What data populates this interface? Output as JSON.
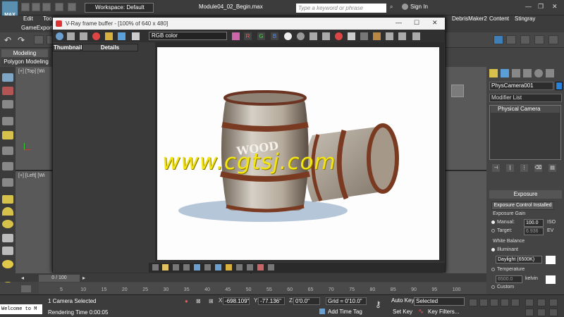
{
  "app": {
    "logo_text": "MAX",
    "document_title": "Module04_02_Begin.max",
    "workspace": "Workspace: Default",
    "search_placeholder": "Type a keyword or phrase",
    "sign_in": "Sign In"
  },
  "menus": [
    "Edit",
    "Too",
    "DebrisMaker2",
    "Content",
    "Stingray"
  ],
  "gamebar_label": "GameExporte",
  "ribbon": {
    "tab": "Modeling",
    "subtab": "Polygon Modeling"
  },
  "viewports": {
    "top": "[+] [Top] [Wi",
    "left": "[+] [Left] [Wi"
  },
  "vfb": {
    "title": "V-Ray frame buffer - [100% of 640 x 480]",
    "channel": "RGB color",
    "rgb_buttons": [
      "R",
      "G",
      "B"
    ],
    "side_tabs": [
      "Thumbnail",
      "Details"
    ]
  },
  "command_panel": {
    "object_name": "PhysCamera001",
    "object_color": "#2a82d8",
    "modifier_list": "Modifier List",
    "stack_item": "Physical Camera",
    "exposure_rollout": "Exposure",
    "exposure_control_button": "Exposure Control Installed",
    "exposure_gain_label": "Exposure Gain",
    "manual_label": "Manual:",
    "manual_value": "100.0",
    "manual_unit": "ISO",
    "target_label": "Target:",
    "target_value": "6.936",
    "target_unit": "EV",
    "white_balance_label": "White Balance",
    "illuminant_label": "Illuminant",
    "illuminant_value": "Daylight (6500K)",
    "temperature_label": "Temperature",
    "temperature_value": "6500.0",
    "temperature_unit": "kelvin",
    "custom_label": "Custom"
  },
  "timeline": {
    "slider": "0 / 100",
    "ticks": [
      "5",
      "10",
      "15",
      "20",
      "25",
      "30",
      "35",
      "40",
      "45",
      "50",
      "55",
      "60",
      "65",
      "70",
      "75",
      "80",
      "85",
      "90",
      "95",
      "100"
    ]
  },
  "status": {
    "maxscript": "Welcome to M",
    "selection": "1 Camera Selected",
    "render_time": "Rendering Time  0:00:05",
    "x_label": "X:",
    "x_value": "-698.109\"",
    "y_label": "Y:",
    "y_value": "-77.136\"",
    "z_label": "Z:",
    "z_value": "0'0.0\"",
    "grid": "Grid = 0'10.0\"",
    "add_time_tag": "Add Time Tag",
    "auto_key": "Auto Key",
    "set_key": "Set Key",
    "selected": "Selected",
    "key_filters": "Key Filters..."
  },
  "watermark": "www.cgtsj.com"
}
